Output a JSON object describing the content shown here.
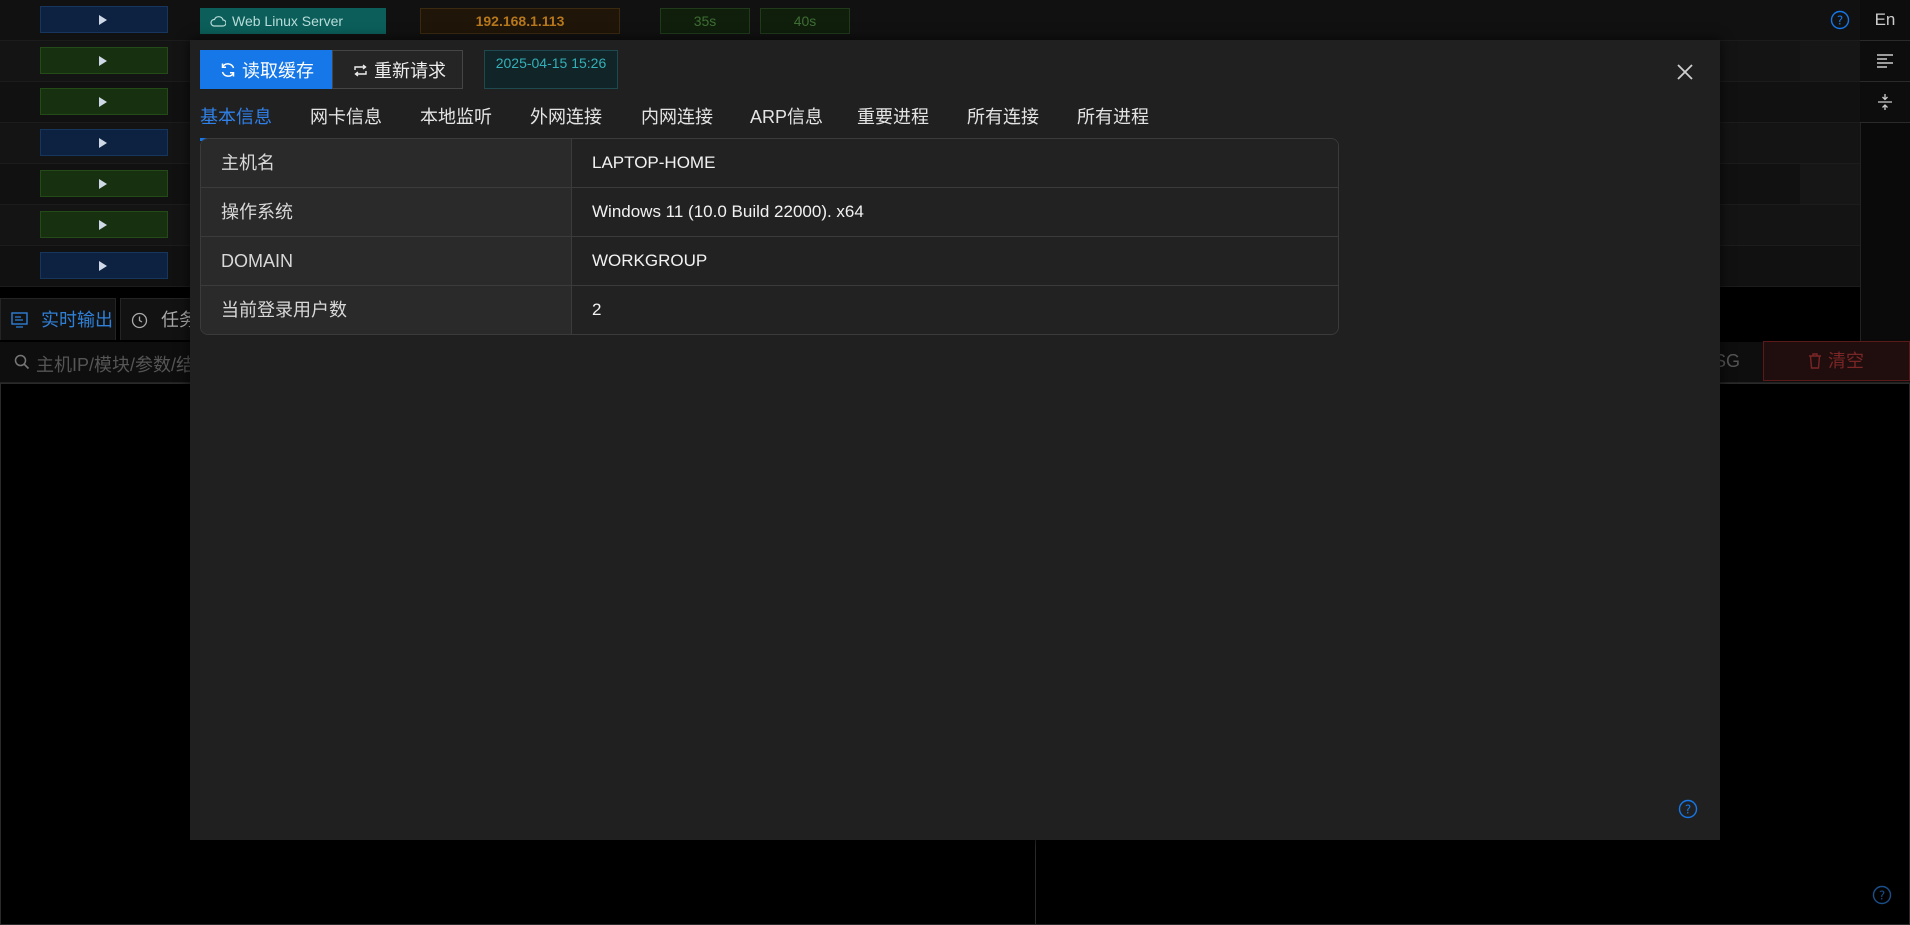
{
  "background": {
    "server_tag": "Web Linux Server",
    "ip": "192.168.1.113",
    "times": [
      "35s",
      "40s"
    ],
    "lang_button": "En",
    "log_tabs": [
      "实时输出",
      "任务"
    ],
    "search_placeholder": "主机IP/模块/参数/结",
    "msg_fragment": "SG",
    "clear_label": "清空"
  },
  "modal": {
    "read_cache_label": "读取缓存",
    "re_request_label": "重新请求",
    "timestamp": "2025-04-15 15:26",
    "tabs": [
      "基本信息",
      "网卡信息",
      "本地监听",
      "外网连接",
      "内网连接",
      "ARP信息",
      "重要进程",
      "所有连接",
      "所有进程"
    ],
    "active_tab": "基本信息",
    "info": [
      {
        "key": "主机名",
        "value": "LAPTOP-HOME"
      },
      {
        "key": "操作系统",
        "value": "Windows 11 (10.0 Build 22000). x64"
      },
      {
        "key": "DOMAIN",
        "value": "WORKGROUP"
      },
      {
        "key": "当前登录用户数",
        "value": "2"
      }
    ]
  },
  "colors": {
    "accent": "#1677e8",
    "server_tag": "#0b5e5a",
    "ip_text": "#b7781c",
    "danger": "#7a2626"
  }
}
